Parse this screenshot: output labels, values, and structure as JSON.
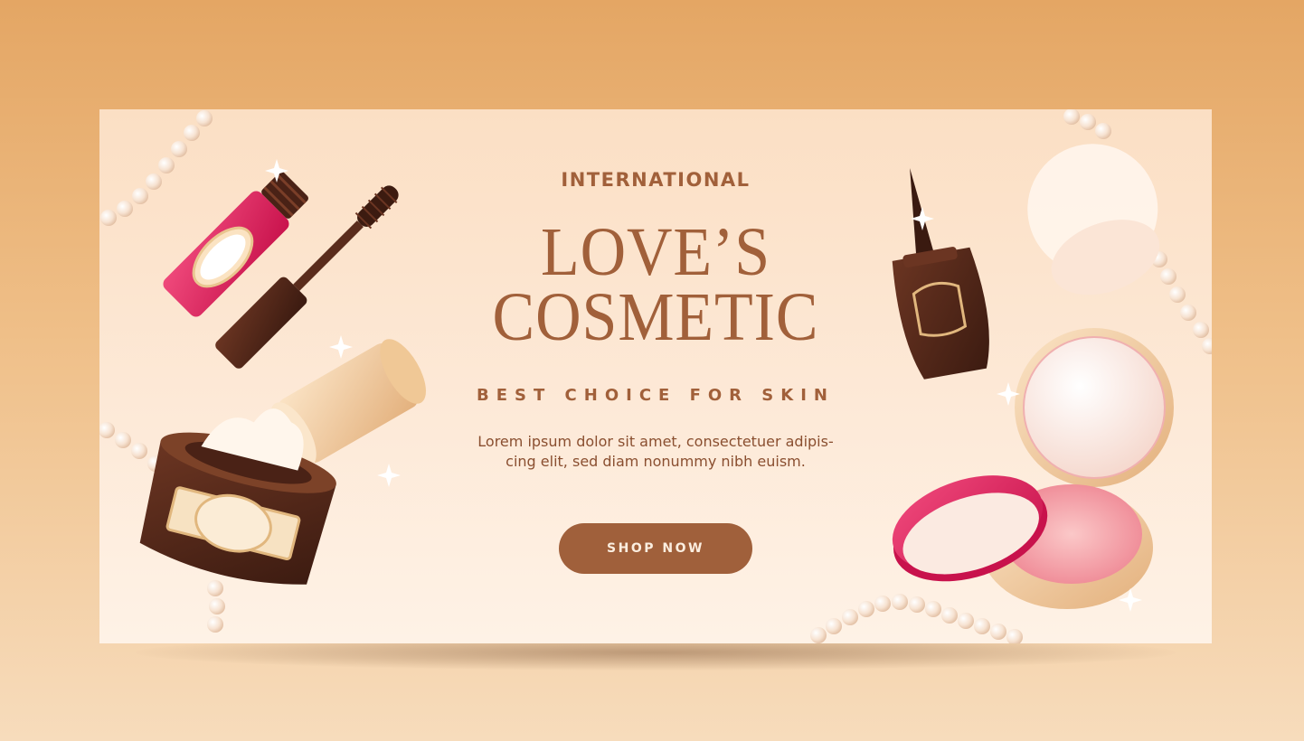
{
  "banner": {
    "eyebrow": "INTERNATIONAL",
    "title_line1": "LOVE’S",
    "title_line2": "COSMETIC",
    "tagline": "BEST CHOICE FOR SKIN",
    "body_line1": "Lorem ipsum dolor sit amet, consectetuer adipis-",
    "body_line2": "cing elit, sed diam nonummy nibh euism.",
    "cta_label": "SHOP NOW"
  },
  "colors": {
    "background": "#e4a664",
    "banner": "#fde9d7",
    "accent_brown": "#a0603b",
    "accent_pink": "#e0245e"
  },
  "illustrations": [
    "mascara-icon",
    "cream-jar-icon",
    "nail-polish-icon",
    "powder-puff-icon",
    "compact-powder-icon",
    "pearl-string-icon"
  ]
}
